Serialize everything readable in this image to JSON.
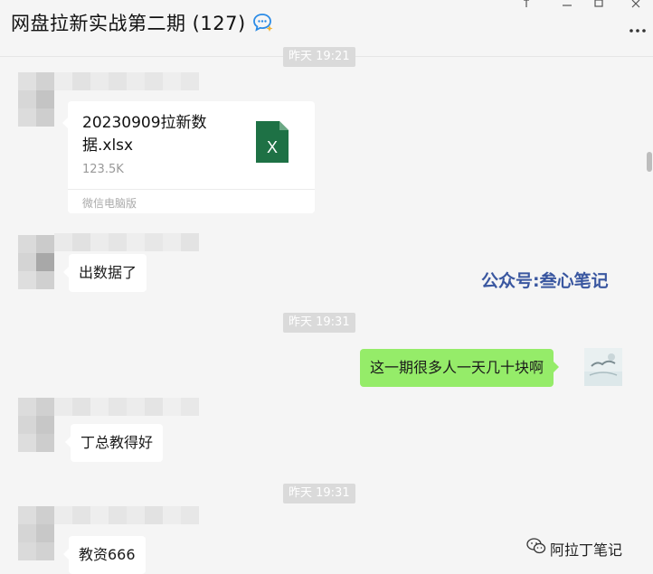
{
  "header": {
    "title": "网盘拉新实战第二期 (127)"
  },
  "messages": {
    "top_partial_timestamp": "昨天 19:21",
    "file": {
      "name": "20230909拉新数据.xlsx",
      "size": "123.5K",
      "source": "微信电脑版",
      "icon": "excel-file-icon",
      "icon_letter": "X",
      "icon_color": "#1e7145"
    },
    "msg1": "出数据了",
    "timestamp1": "昨天 19:31",
    "my_msg": "这一期很多人一天几十块啊",
    "msg2": "丁总教得好",
    "timestamp2": "昨天 19:31",
    "msg3": "教资666"
  },
  "watermarks": {
    "top": "公众号:叁心笔记",
    "bottom": "阿拉丁笔记"
  },
  "colors": {
    "background": "#f5f5f5",
    "my_bubble": "#95ec69",
    "other_bubble": "#ffffff",
    "timestamp_bg": "#dadada",
    "watermark_blue": "#3a57a0"
  }
}
